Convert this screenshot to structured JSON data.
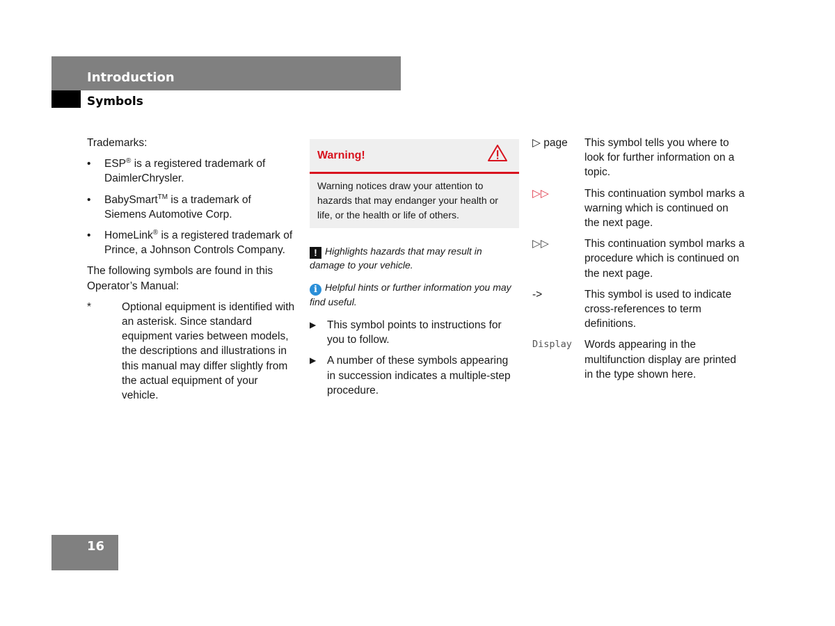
{
  "header": {
    "chapter": "Introduction",
    "section": "Symbols"
  },
  "column1": {
    "trademarks_heading": "Trademarks:",
    "trademarks": [
      {
        "name": "ESP",
        "mark": "®",
        "text": " is a registered trademark of DaimlerChrysler."
      },
      {
        "name": "BabySmart",
        "mark": "TM",
        "text": " is a trademark of Siemens Automotive Corp."
      },
      {
        "name": "HomeLink",
        "mark": "®",
        "text": " is a registered trademark of Prince, a Johnson Controls Company."
      }
    ],
    "bullet_glyph": "•",
    "symbols_intro": "The following symbols are found in this Operator’s Manual:",
    "asterisk_symbol": "*",
    "asterisk_text": "Optional equipment is identified with an asterisk. Since standard equipment varies between models, the descriptions and illustrations in this manual may differ slightly from the actual equipment of your vehicle."
  },
  "column2": {
    "warning": {
      "title": "Warning!",
      "icon": "warning-triangle-icon",
      "body": "Warning notices draw your attention to hazards that may endanger your health or life, or the health or life of others.",
      "accent_color": "#d8131e"
    },
    "notes": [
      {
        "icon": "exclamation-icon",
        "glyph": "!",
        "text": "Highlights hazards that may result in damage to your vehicle."
      },
      {
        "icon": "info-icon",
        "glyph": "i",
        "text": "Helpful hints or further information you may find useful."
      }
    ],
    "step_glyph": "▶",
    "steps": [
      "This symbol points to instructions for you to follow.",
      "A number of these symbols appearing in succession indicates a multiple-step procedure."
    ]
  },
  "column3": {
    "definitions": [
      {
        "symbol": "▷ page",
        "style": "normal",
        "text": "This symbol tells you where to look for further information on a topic."
      },
      {
        "symbol": "▷▷",
        "style": "red",
        "text": "This continuation symbol marks a warning which is continued on the next page."
      },
      {
        "symbol": "▷▷",
        "style": "gray",
        "text": "This continuation symbol marks a procedure which is continued on the next page."
      },
      {
        "symbol": "->",
        "style": "normal",
        "text": "This symbol is used to indicate cross-references to term definitions."
      },
      {
        "symbol": "Display",
        "style": "mono",
        "text": "Words appearing in the multifunction display are printed in the type shown here."
      }
    ]
  },
  "footer": {
    "page_number": "16"
  }
}
